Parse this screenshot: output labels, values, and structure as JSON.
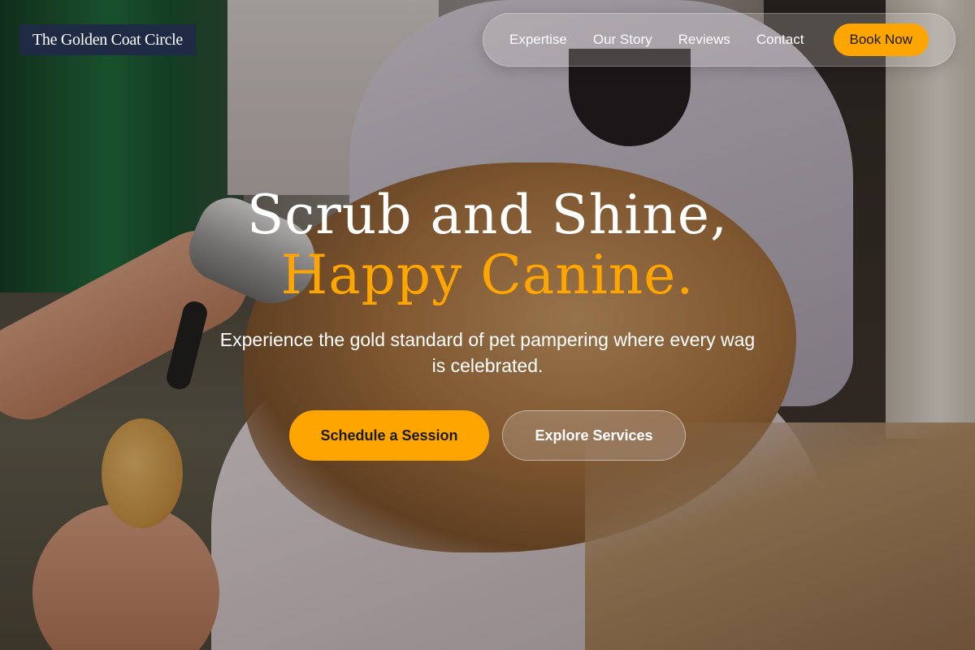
{
  "brand": {
    "name": "The Golden Coat Circle"
  },
  "nav": {
    "links": [
      {
        "label": "Expertise"
      },
      {
        "label": "Our Story"
      },
      {
        "label": "Reviews"
      },
      {
        "label": "Contact"
      }
    ],
    "cta_label": "Book Now"
  },
  "hero": {
    "title_line1": "Scrub and Shine,",
    "title_line2": "Happy Canine.",
    "subtitle": "Experience the gold standard of pet pampering where every wag is celebrated.",
    "primary_button": "Schedule a Session",
    "secondary_button": "Explore Services",
    "background_image": "groomer-drying-dog-photo"
  },
  "colors": {
    "accent": "#ffa500",
    "logo_background": "#1f2a44",
    "text_light": "#ffffff",
    "button_text_dark": "#1a1a1a"
  }
}
